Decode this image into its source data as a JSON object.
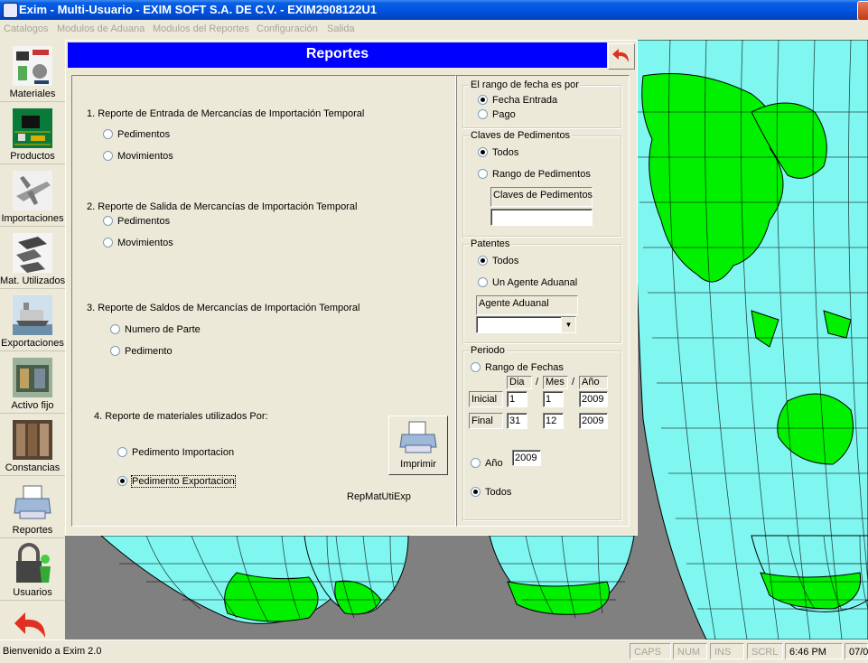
{
  "window": {
    "title": "Exim - Multi-Usuario - EXIM SOFT S.A. DE C.V. - EXIM2908122U1"
  },
  "menu": [
    "Catalogos",
    "Modulos de Aduana",
    "Modulos del Reportes",
    "Configuración",
    "Salida"
  ],
  "toolbar": [
    {
      "label": "Materiales",
      "icon": "materials-icon"
    },
    {
      "label": "Productos",
      "icon": "circuit-board-icon"
    },
    {
      "label": "Importaciones",
      "icon": "airplane-icon"
    },
    {
      "label": "Mat. Utilizados",
      "icon": "parts-icon"
    },
    {
      "label": "Exportaciones",
      "icon": "ship-icon"
    },
    {
      "label": "Activo fijo",
      "icon": "warehouse-icon"
    },
    {
      "label": "Constancias",
      "icon": "archive-icon"
    },
    {
      "label": "Reportes",
      "icon": "printer-icon"
    },
    {
      "label": "Usuarios",
      "icon": "padlock-user-icon"
    },
    {
      "label": "",
      "icon": "back-arrow-icon"
    }
  ],
  "status": {
    "message": "Bienvenido a Exim 2.0",
    "caps": "CAPS",
    "num": "NUM",
    "ins": "INS",
    "scrl": "SCRL",
    "time": "6:46 PM",
    "date": "07/0"
  },
  "dialog": {
    "title": "Reportes",
    "sections": {
      "s1": {
        "title": "1. Reporte de Entrada de Mercancías de Importación Temporal",
        "options": [
          "Pedimentos",
          "Movimientos"
        ]
      },
      "s2": {
        "title": "2.  Reporte de Salida de Mercancías de Importación Temporal",
        "options": [
          "Pedimentos",
          "Movimientos"
        ]
      },
      "s3": {
        "title": "3. Reporte de Saldos de Mercancías de Importación Temporal",
        "options": [
          "Numero de Parte",
          "Pedimento"
        ]
      },
      "s4": {
        "title": "4. Reporte de materiales utilizados Por:",
        "options": [
          "Pedimento Importacion",
          "Pedimento Exportacion"
        ],
        "selected": "Pedimento Exportacion"
      }
    },
    "print_label": "Imprimir",
    "report_name": "RepMatUtiExp",
    "fecha": {
      "title": "El rango de fecha es por",
      "options": [
        "Fecha Entrada",
        "Pago"
      ],
      "selected": "Fecha Entrada"
    },
    "claves": {
      "title": "Claves de Pedimentos",
      "options": [
        "Todos",
        "Rango de Pedimentos"
      ],
      "selected": "Todos",
      "box_label": "Claves de Pedimentos",
      "value": ""
    },
    "patentes": {
      "title": "Patentes",
      "options": [
        "Todos",
        "Un Agente Aduanal"
      ],
      "selected": "Todos",
      "box_label": "Agente Aduanal",
      "value": ""
    },
    "periodo": {
      "title": "Periodo",
      "rango_label": "Rango de Fechas",
      "dia": "Dia",
      "slash": "/",
      "mes": "Mes",
      "anio": "Año",
      "inicial": {
        "label": "Inicial",
        "dia": "1",
        "mes": "1",
        "anio": "2009"
      },
      "final": {
        "label": "Final",
        "dia": "31",
        "mes": "12",
        "anio": "2009"
      },
      "anio_label": "Año",
      "anio_value": "2009",
      "todos_label": "Todos",
      "selected": "Todos"
    }
  }
}
